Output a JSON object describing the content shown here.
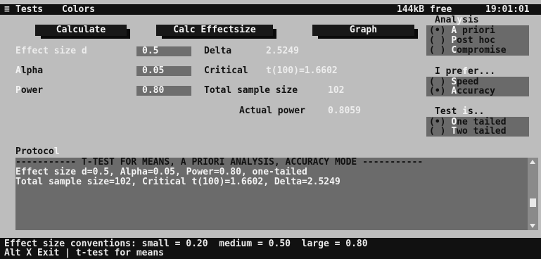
{
  "menubar": {
    "menu_glyph": "≡",
    "items": [
      "Tests",
      "Colors"
    ],
    "memory": "144kB free",
    "clock": "19:01:01"
  },
  "buttons": {
    "calculate": "Calculate",
    "calc_effectsize": "Calc Effectsize",
    "graph": "Graph"
  },
  "fields": {
    "effect_size": {
      "hotkey": "E",
      "rest": "ffect size d",
      "value": "0.5"
    },
    "alpha": {
      "hotkey": "A",
      "rest": "lpha",
      "value": "0.05"
    },
    "power": {
      "hotkey": "P",
      "rest": "ower",
      "value": "0.80"
    }
  },
  "results": {
    "delta_label": "Delta",
    "delta_value": "2.5249",
    "critical_label": "Critical",
    "critical_value": "t(100)=1.6602",
    "total_label": "Total sample size",
    "total_value": "102",
    "actual_power_label": "Actual power",
    "actual_power_value": "0.8059"
  },
  "analysis": {
    "title_a": "Anal",
    "title_b": "y",
    "title_c": "sis",
    "options": [
      {
        "mark": "(•)",
        "hotkey": "A",
        "rest": " priori"
      },
      {
        "mark": "( )",
        "hotkey": "P",
        "rest": "ost hoc"
      },
      {
        "mark": "( )",
        "hotkey": "C",
        "rest": "ompromise"
      }
    ]
  },
  "prefer": {
    "title_a": "I pre",
    "title_b": "f",
    "title_c": "er...",
    "options": [
      {
        "mark": "( )",
        "hotkey": "S",
        "rest": "peed"
      },
      {
        "mark": "(•)",
        "hotkey": "A",
        "rest": "ccuracy"
      }
    ]
  },
  "test": {
    "title_a": "Test ",
    "title_b": "i",
    "title_c": "s..",
    "options": [
      {
        "mark": "(•)",
        "hotkey": "O",
        "rest": "ne tailed"
      },
      {
        "mark": "( )",
        "hotkey": "T",
        "rest": "wo tailed"
      }
    ]
  },
  "protocol": {
    "title_a": "Protoco",
    "title_b": "l",
    "lines": [
      "----------- T-TEST FOR MEANS, A PRIORI ANALYSIS, ACCURACY MODE -----------",
      "Effect size d=0.5, Alpha=0.05, Power=0.80, one-tailed",
      "Total sample size=102, Critical t(100)=1.6602, Delta=2.5249"
    ]
  },
  "status": {
    "line1": "Effect size conventions: small = 0.20  medium = 0.50  large = 0.80",
    "line2": "Alt X Exit | t-test for means"
  }
}
